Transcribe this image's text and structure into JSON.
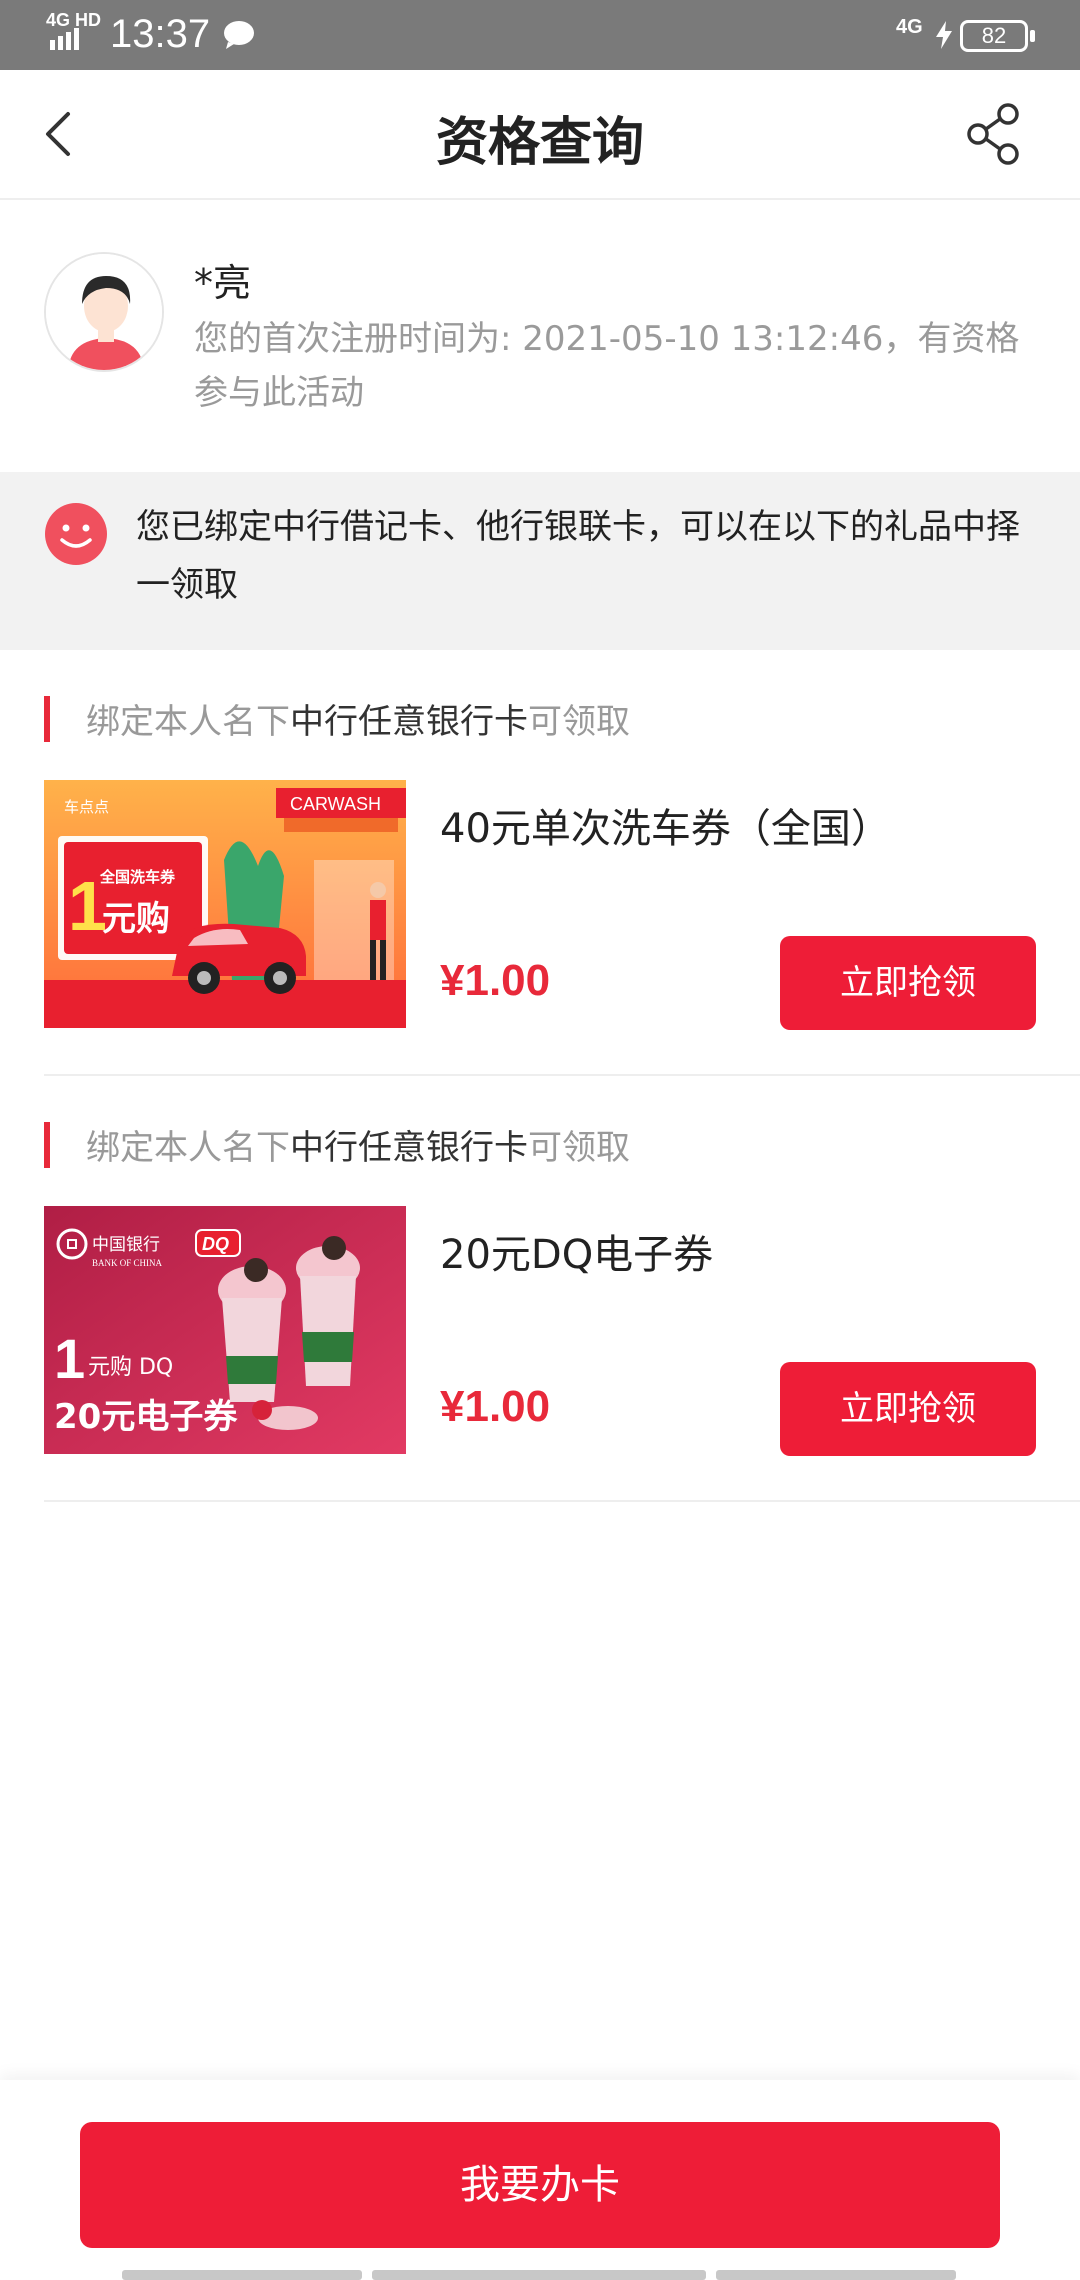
{
  "status_bar": {
    "network": "4G HD",
    "time": "13:37",
    "net2": "4G",
    "battery": "82"
  },
  "nav": {
    "title": "资格查询",
    "back_icon": "chevron-left-icon",
    "share_icon": "share-icon"
  },
  "user": {
    "name": "*亮",
    "desc": "您的首次注册时间为: 2021-05-10 13:12:46，有资格参与此活动"
  },
  "notice": {
    "icon": "smile-icon",
    "text": "您已绑定中行借记卡、他行银联卡，可以在以下的礼品中择一领取"
  },
  "offers": [
    {
      "cond_pre": "绑定本人名下",
      "cond_hl": "中行任意银行卡",
      "cond_post": "可领取",
      "title": "40元单次洗车券（全国）",
      "price": "¥1.00",
      "button": "立即抢领",
      "img_brand": "车点点",
      "img_sign": "CARWASH",
      "img_tag": "全国洗车券",
      "img_big": "1",
      "img_big2": "元购"
    },
    {
      "cond_pre": "绑定本人名下",
      "cond_hl": "中行任意银行卡",
      "cond_post": "可领取",
      "title": "20元DQ电子券",
      "price": "¥1.00",
      "button": "立即抢领",
      "img_brand": "中国银行",
      "img_brand_en": "BANK OF CHINA",
      "img_logo": "DQ",
      "img_line1_big": "1",
      "img_line1": "元购 DQ",
      "img_line2": "20元电子券"
    }
  ],
  "cta": {
    "label": "我要办卡"
  },
  "colors": {
    "accent": "#ee1d37",
    "status_bar": "#7a7a7a",
    "notice_bg": "#f2f2f2"
  }
}
